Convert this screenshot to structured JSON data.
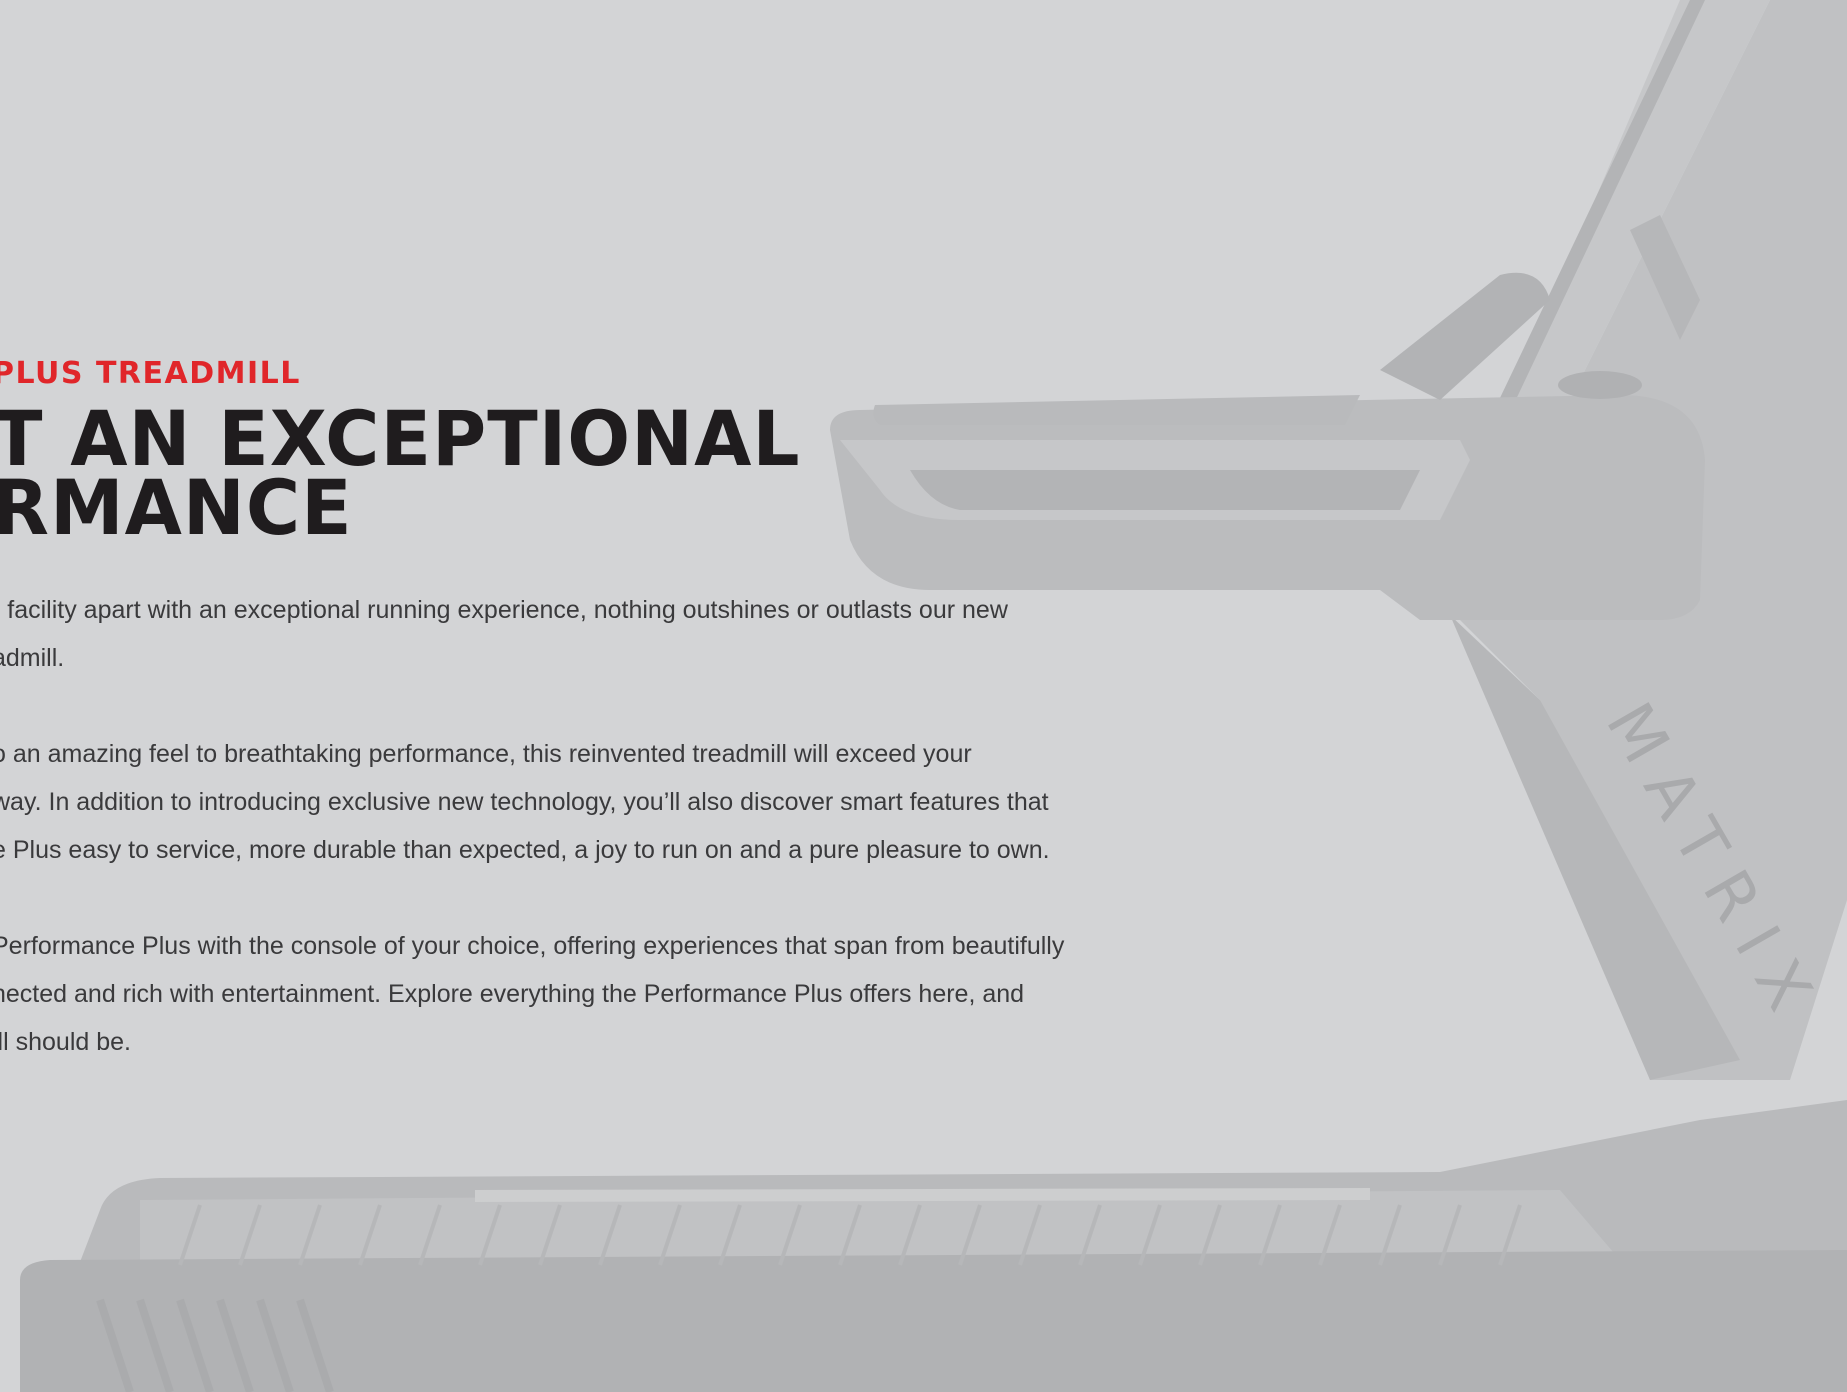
{
  "hero": {
    "eyebrow": "PLUS TREADMILL",
    "headline_lines": [
      "T AN EXCEPTIONAL",
      "RMANCE"
    ],
    "paragraphs": [
      [
        "r facility apart with an exceptional running experience, nothing outshines or outlasts our new",
        "admill."
      ],
      [
        "o an amazing feel to breathtaking performance, this reinvented treadmill will exceed your",
        " way. In addition to introducing exclusive new technology, you’ll also discover smart features that",
        "e Plus easy to service, more durable than expected, a joy to run on and a pure pleasure to own."
      ],
      [
        " Performance Plus with the console of your choice, offering experiences that span from beautifully",
        "nected and rich with entertainment. Explore everything the Performance Plus offers here, and",
        "ill should be."
      ]
    ]
  },
  "background": {
    "brand_text": "MATRIX",
    "colors": {
      "page": "#d3d4d6",
      "treadmill_light": "#c3c4c6",
      "treadmill_mid": "#b8b9bb",
      "treadmill_dark": "#aeafb1",
      "eyebrow": "#e0262a",
      "headline": "#1f1c1e",
      "body": "#3a3a3c"
    }
  }
}
